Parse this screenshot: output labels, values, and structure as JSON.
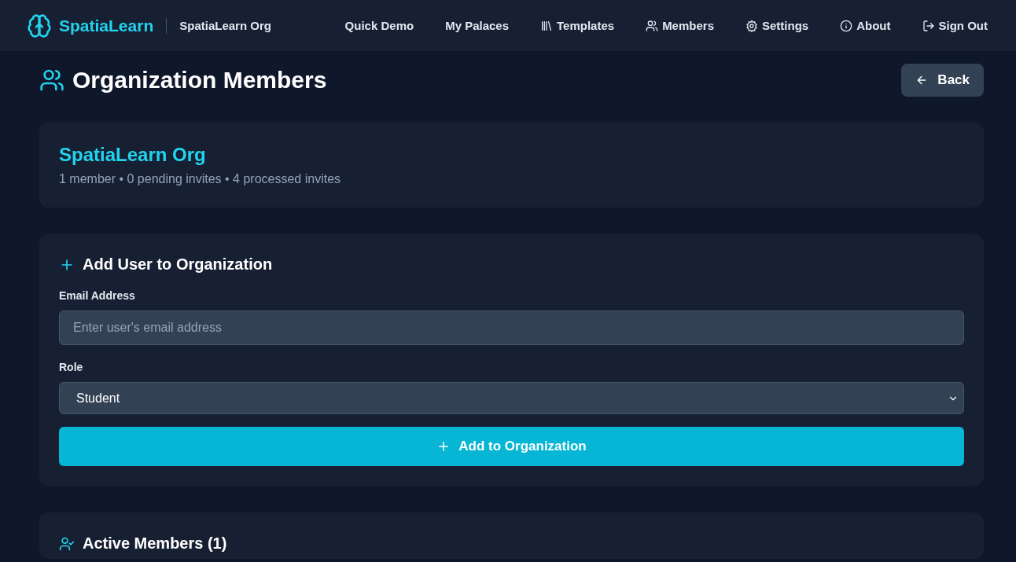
{
  "brand": {
    "name": "SpatiaLearn",
    "org": "SpatiaLearn Org"
  },
  "nav": [
    "Quick Demo",
    "My Palaces",
    "Templates",
    "Members",
    "Settings",
    "About",
    "Sign Out"
  ],
  "page": {
    "title": "Organization Members",
    "back": "Back"
  },
  "org_card": {
    "name": "SpatiaLearn Org",
    "stats": [
      "1 member",
      "0 pending invites",
      "4 processed invites"
    ],
    "separator": "•"
  },
  "add_form": {
    "title": "Add User to Organization",
    "email_label": "Email Address",
    "email_placeholder": "Enter user's email address",
    "role_label": "Role",
    "role_value": "Student",
    "submit": "Add to Organization"
  },
  "members_section": {
    "title": "Active Members (1)"
  }
}
